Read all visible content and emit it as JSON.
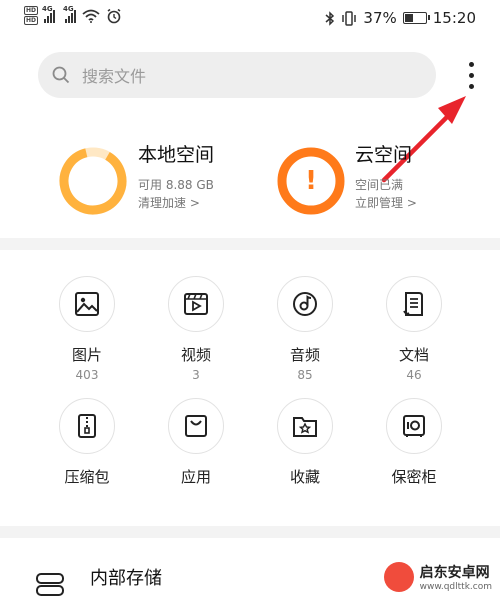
{
  "status_bar": {
    "hd1": "HD",
    "hd2": "HD",
    "net1": "4G",
    "net2": "4G",
    "battery_percent": "37%",
    "battery_level": 0.37,
    "time": "15:20"
  },
  "search": {
    "placeholder": "搜索文件"
  },
  "storage": {
    "local": {
      "title": "本地空间",
      "available": "可用 8.88 GB",
      "action": "清理加速 >"
    },
    "cloud": {
      "title": "云空间",
      "status": "空间已满",
      "action": "立即管理 >",
      "alert_symbol": "!"
    }
  },
  "categories": [
    {
      "label": "图片",
      "count": "403",
      "icon": "image-icon"
    },
    {
      "label": "视频",
      "count": "3",
      "icon": "video-icon"
    },
    {
      "label": "音频",
      "count": "85",
      "icon": "audio-icon"
    },
    {
      "label": "文档",
      "count": "46",
      "icon": "document-icon"
    },
    {
      "label": "压缩包",
      "icon": "archive-icon"
    },
    {
      "label": "应用",
      "icon": "app-bag-icon"
    },
    {
      "label": "收藏",
      "icon": "favorite-folder-icon"
    },
    {
      "label": "保密柜",
      "icon": "safe-icon"
    }
  ],
  "internal_storage": {
    "label": "内部存储"
  },
  "watermark": {
    "name": "启东安卓网",
    "url": "www.qdlttk.com"
  },
  "colors": {
    "local_ring": "#FFB23E",
    "cloud_ring": "#FF7A1A",
    "arrow": "#E8242C"
  }
}
